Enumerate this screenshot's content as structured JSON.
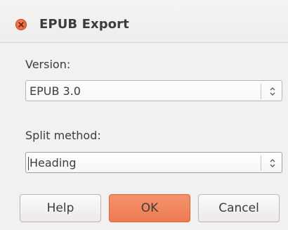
{
  "window": {
    "title": "EPUB Export"
  },
  "version": {
    "label": "Version:",
    "selected": "EPUB 3.0"
  },
  "split_method": {
    "label": "Split method:",
    "selected": "Heading"
  },
  "buttons": {
    "help": "Help",
    "ok": "OK",
    "cancel": "Cancel"
  },
  "colors": {
    "accent": "#ee7a51",
    "close": "#e35a2f",
    "background": "#f2f1f0"
  },
  "icons": {
    "close": "close-icon",
    "spinner": "up-down-arrows-icon"
  }
}
